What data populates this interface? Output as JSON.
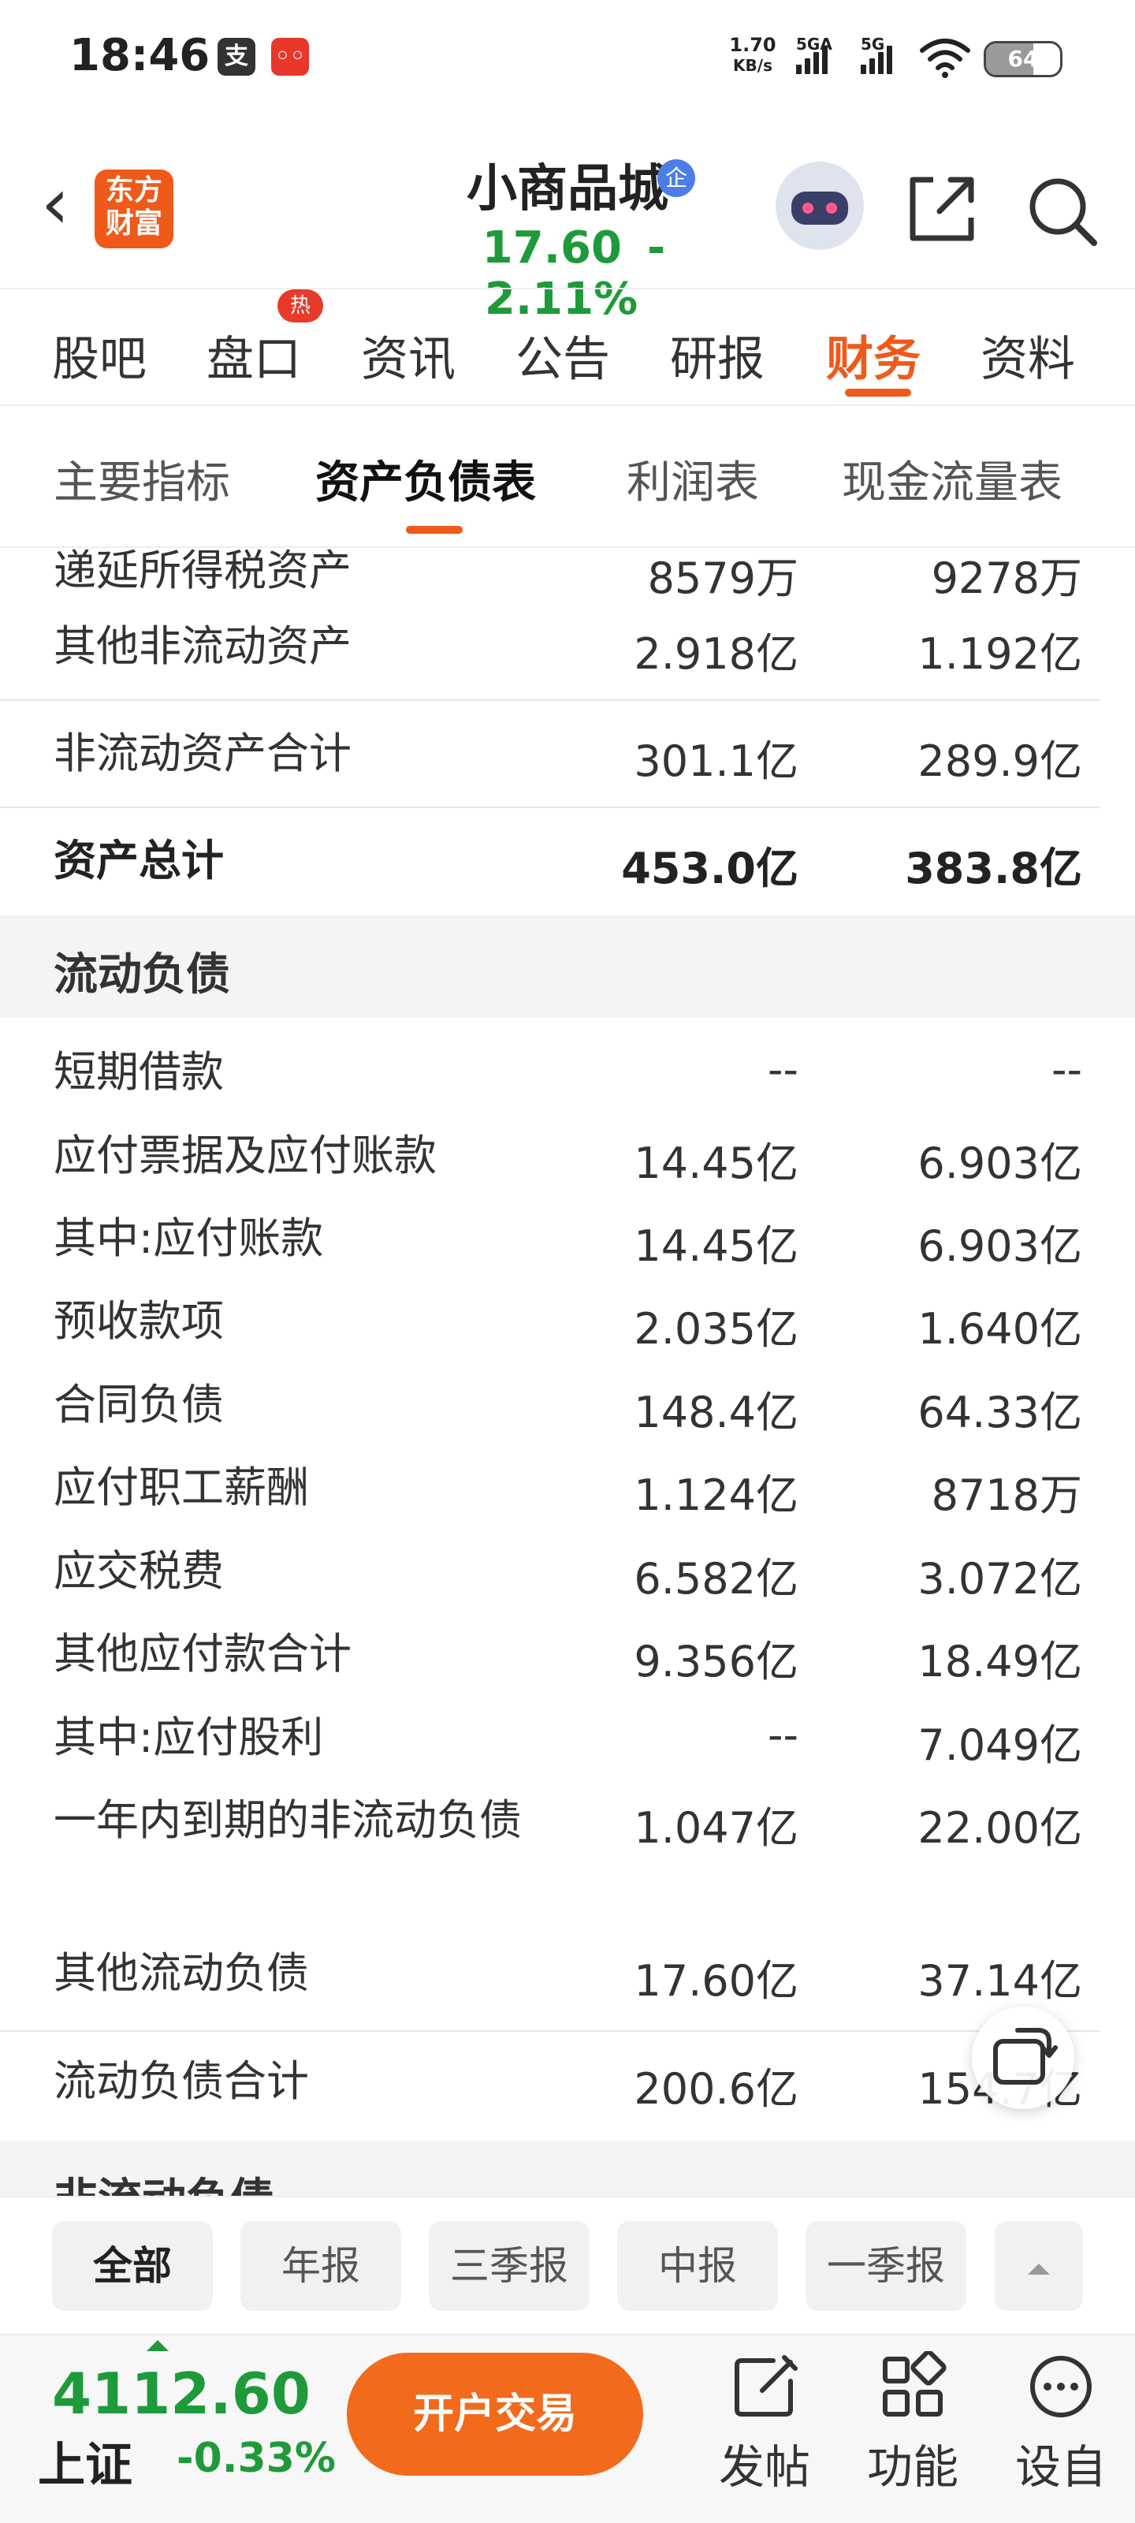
{
  "status_bar": {
    "time": "18:46",
    "speed_value": "1.70",
    "speed_unit": "KB/s",
    "sim1_label": "5GA",
    "sim2_label": "5G",
    "battery_text": "64",
    "battery_level": 0.64,
    "app_icon_1": "alipay-icon",
    "app_icon_2": "notification-app-icon"
  },
  "header": {
    "back_icon": "back-arrow-icon",
    "logo_line1": "东方",
    "logo_line2": "财富",
    "stock_name": "小商品城",
    "badge": "企",
    "price": "17.60",
    "change_pct": "-2.11%",
    "price_color": "#1e9a3a"
  },
  "main_tabs": [
    {
      "label": "股吧"
    },
    {
      "label": "盘口",
      "badge": "热"
    },
    {
      "label": "资讯"
    },
    {
      "label": "公告"
    },
    {
      "label": "研报"
    },
    {
      "label": "财务",
      "active": true
    },
    {
      "label": "资料"
    }
  ],
  "sub_tabs": [
    {
      "label": "主要指标"
    },
    {
      "label": "资产负债表",
      "active": true
    },
    {
      "label": "利润表"
    },
    {
      "label": "现金流量表"
    }
  ],
  "table": {
    "rows": [
      {
        "name": "递延所得税资产",
        "v1": "8579万",
        "v2": "9278万"
      },
      {
        "name": "其他非流动资产",
        "v1": "2.918亿",
        "v2": "1.192亿"
      },
      {
        "name": "非流动资产合计",
        "v1": "301.1亿",
        "v2": "289.9亿"
      },
      {
        "name": "资产总计",
        "v1": "453.0亿",
        "v2": "383.8亿"
      },
      {
        "name": "流动负债"
      },
      {
        "name": "短期借款",
        "v1": "--",
        "v2": "--"
      },
      {
        "name": "应付票据及应付账款",
        "v1": "14.45亿",
        "v2": "6.903亿"
      },
      {
        "name": "其中:应付账款",
        "v1": "14.45亿",
        "v2": "6.903亿"
      },
      {
        "name": "预收款项",
        "v1": "2.035亿",
        "v2": "1.640亿"
      },
      {
        "name": "合同负债",
        "v1": "148.4亿",
        "v2": "64.33亿"
      },
      {
        "name": "应付职工薪酬",
        "v1": "1.124亿",
        "v2": "8718万"
      },
      {
        "name": "应交税费",
        "v1": "6.582亿",
        "v2": "3.072亿"
      },
      {
        "name": "其他应付款合计",
        "v1": "9.356亿",
        "v2": "18.49亿"
      },
      {
        "name": "其中:应付股利",
        "v1": "--",
        "v2": "7.049亿"
      },
      {
        "name": "一年内到期的非流动负债",
        "v1": "1.047亿",
        "v2": "22.00亿"
      },
      {
        "name": "其他流动负债",
        "v1": "17.60亿",
        "v2": "37.14亿"
      },
      {
        "name": "流动负债合计",
        "v1": "200.6亿",
        "v2": "154.7亿"
      },
      {
        "name": "非流动负债"
      }
    ]
  },
  "period_filters": [
    {
      "label": "全部",
      "active": true
    },
    {
      "label": "年报"
    },
    {
      "label": "三季报"
    },
    {
      "label": "中报"
    },
    {
      "label": "一季报"
    }
  ],
  "bottom_bar": {
    "index_value": "4112.60",
    "index_name": "上证",
    "index_change": "-0.33%",
    "trade_button": "开户交易",
    "actions": [
      {
        "label": "发帖",
        "icon": "edit-icon"
      },
      {
        "label": "功能",
        "icon": "grid-icon"
      },
      {
        "label": "设自",
        "icon": "more-icon"
      }
    ]
  }
}
